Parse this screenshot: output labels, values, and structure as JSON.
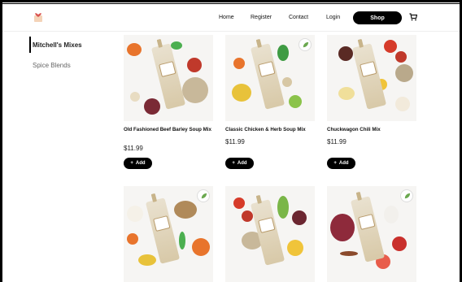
{
  "nav": {
    "home": "Home",
    "register": "Register",
    "contact": "Contact",
    "login": "Login",
    "shop": "Shop"
  },
  "sidebar": {
    "items": [
      {
        "label": "Mitchell's Mixes",
        "active": true
      },
      {
        "label": "Spice Blends",
        "active": false
      }
    ]
  },
  "products": [
    {
      "title": "Old Fashioned Beef Barley Soup Mix",
      "price": "$11.99",
      "add_label": "Add",
      "badge": false
    },
    {
      "title": "Classic Chicken & Herb Soup Mix",
      "price": "$11.99",
      "add_label": "Add",
      "badge": true
    },
    {
      "title": "Chuckwagon Chili Mix",
      "price": "$11.99",
      "add_label": "Add",
      "badge": false
    },
    {
      "badge": true
    },
    {
      "badge": false
    },
    {
      "badge": true
    }
  ],
  "colors": {
    "accent": "#000000",
    "brand": "#d9534f",
    "card_bg": "#f6f5f3"
  }
}
